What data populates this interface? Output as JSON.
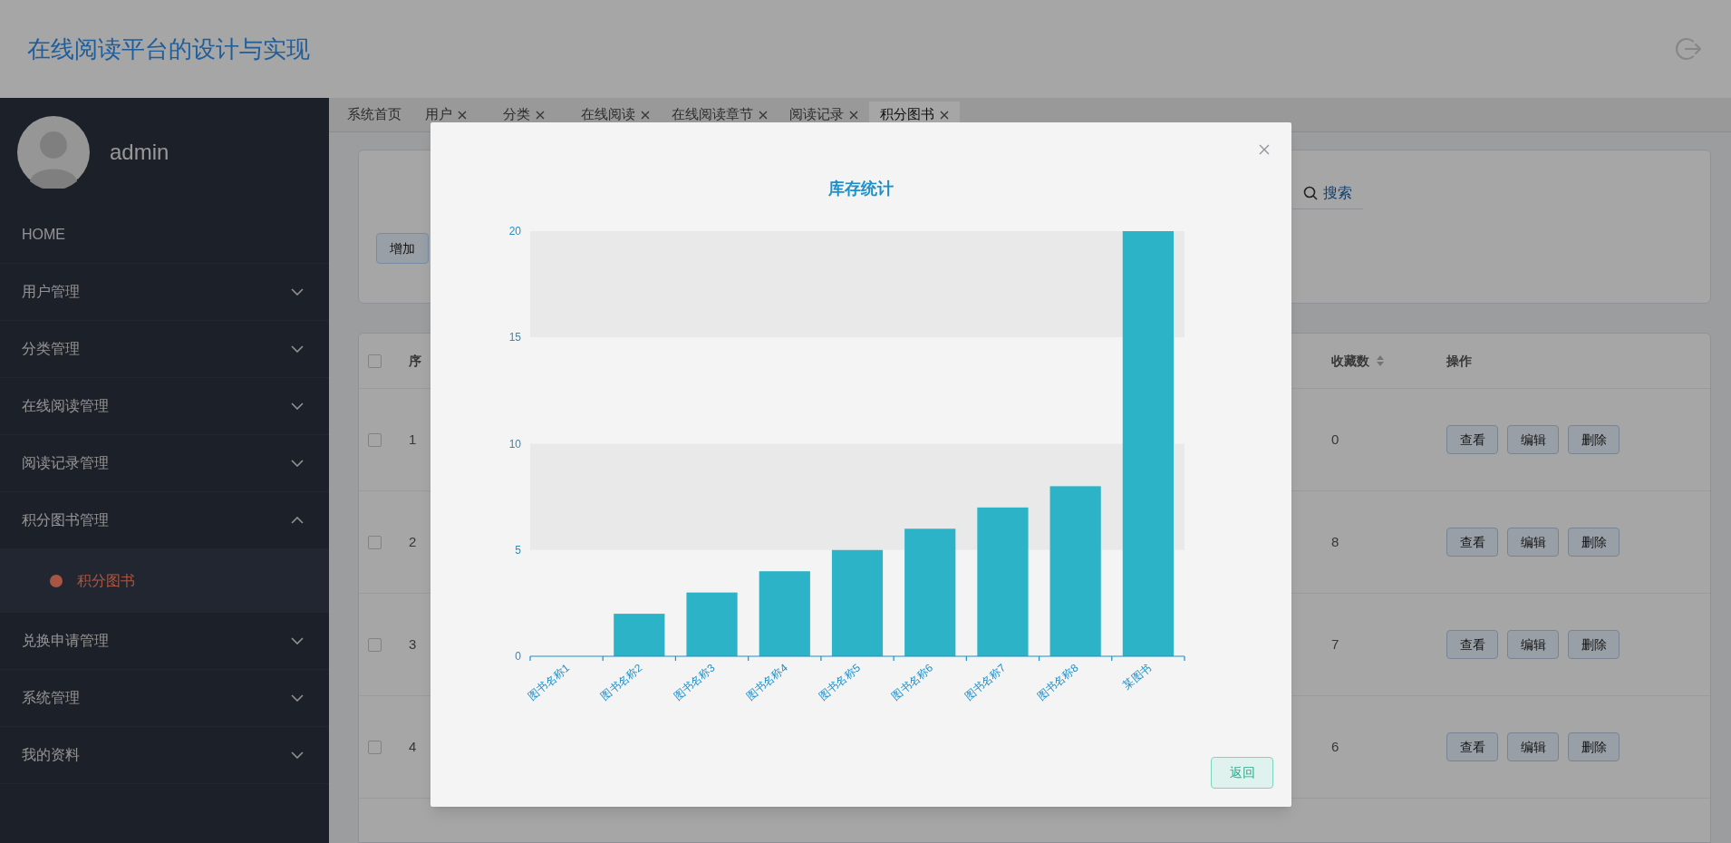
{
  "header": {
    "title": "在线阅读平台的设计与实现"
  },
  "sidebar": {
    "user": "admin",
    "items": [
      {
        "label": "HOME",
        "kind": "link"
      },
      {
        "label": "用户管理",
        "kind": "group",
        "expanded": false
      },
      {
        "label": "分类管理",
        "kind": "group",
        "expanded": false
      },
      {
        "label": "在线阅读管理",
        "kind": "group",
        "expanded": false
      },
      {
        "label": "阅读记录管理",
        "kind": "group",
        "expanded": false
      },
      {
        "label": "积分图书管理",
        "kind": "group",
        "expanded": true,
        "children": [
          {
            "label": "积分图书",
            "selected": true
          }
        ]
      },
      {
        "label": "兑换申请管理",
        "kind": "group",
        "expanded": false
      },
      {
        "label": "系统管理",
        "kind": "group",
        "expanded": false
      },
      {
        "label": "我的资料",
        "kind": "group",
        "expanded": false
      }
    ]
  },
  "tabs": [
    {
      "label": "系统首页",
      "closable": false,
      "selected": false
    },
    {
      "label": "用户",
      "closable": true,
      "selected": false
    },
    {
      "label": "分类",
      "closable": true,
      "selected": false
    },
    {
      "label": "在线阅读",
      "closable": true,
      "selected": false
    },
    {
      "label": "在线阅读章节",
      "closable": true,
      "selected": false
    },
    {
      "label": "阅读记录",
      "closable": true,
      "selected": false
    },
    {
      "label": "积分图书",
      "closable": true,
      "selected": true
    }
  ],
  "search": {
    "button": "搜索"
  },
  "toolbar": [
    {
      "label": "增加"
    }
  ],
  "table": {
    "all_checked": false,
    "columns": [
      {
        "label": "序",
        "sortable": false
      },
      {
        "label": "收藏数",
        "sortable": true
      },
      {
        "label": "操作",
        "sortable": false
      }
    ],
    "rows": [
      {
        "checked": false,
        "cells": [
          "1",
          "0"
        ],
        "actions": [
          "查看",
          "编辑",
          "删除"
        ]
      },
      {
        "checked": false,
        "cells": [
          "2",
          "8"
        ],
        "actions": [
          "查看",
          "编辑",
          "删除"
        ]
      },
      {
        "checked": false,
        "cells": [
          "3",
          "7"
        ],
        "actions": [
          "查看",
          "编辑",
          "删除"
        ]
      },
      {
        "checked": false,
        "cells": [
          "4",
          "6"
        ],
        "actions": [
          "查看",
          "编辑",
          "删除"
        ]
      }
    ]
  },
  "modal": {
    "back_button": "返回",
    "chart_data": {
      "type": "bar",
      "title": "库存统计",
      "categories": [
        "图书名称1",
        "图书名称2",
        "图书名称3",
        "图书名称4",
        "图书名称5",
        "图书名称6",
        "图书名称7",
        "图书名称8",
        "某图书"
      ],
      "values": [
        0,
        2,
        3,
        4,
        5,
        6,
        7,
        8,
        20
      ],
      "ylim": [
        0,
        20
      ],
      "yticks": [
        0,
        5,
        10,
        15,
        20
      ]
    }
  }
}
